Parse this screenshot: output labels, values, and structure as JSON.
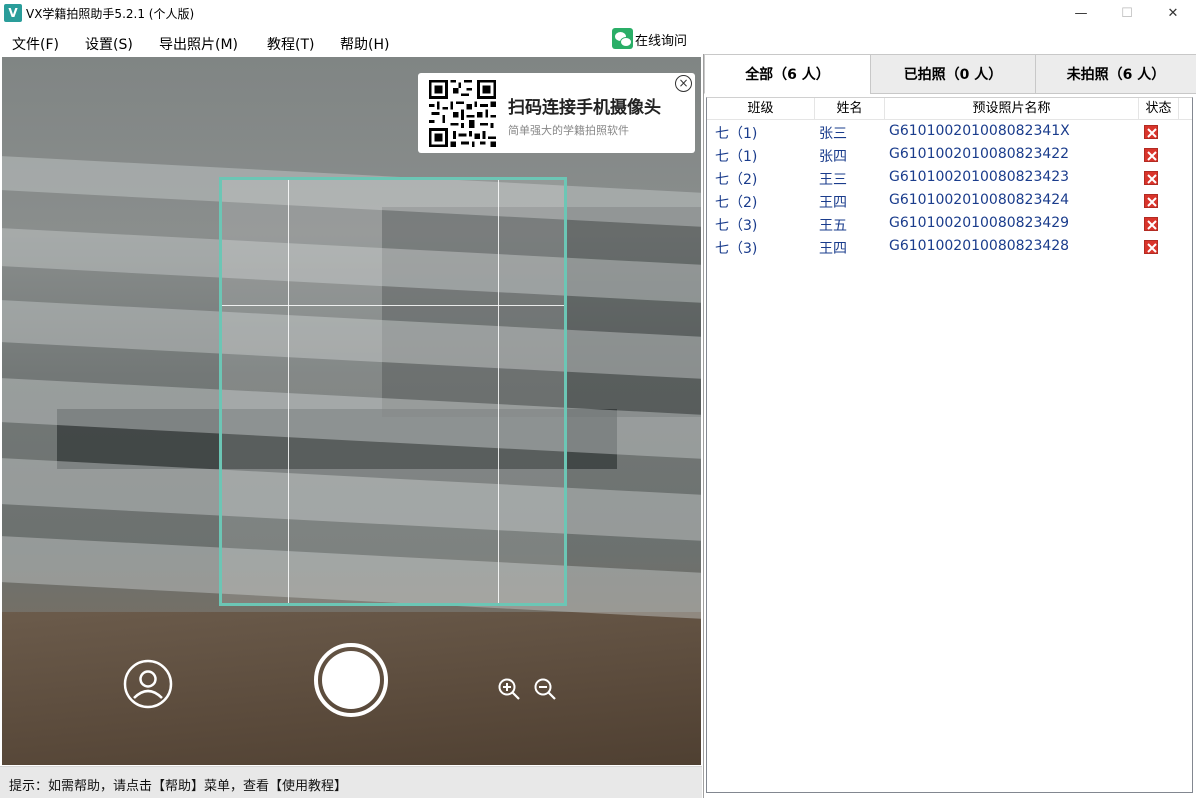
{
  "window": {
    "title": "VX学籍拍照助手5.2.1 (个人版)",
    "app_icon_letter": "V",
    "min_glyph": "—",
    "max_glyph": "☐",
    "close_glyph": "✕"
  },
  "menu": {
    "items": [
      "文件(F)",
      "设置(S)",
      "导出照片(M)",
      "教程(T)",
      "帮助(H)"
    ],
    "online_label": "在线询问"
  },
  "qr_card": {
    "title": "扫码连接手机摄像头",
    "subtitle": "简单强大的学籍拍照软件",
    "close_glyph": "×"
  },
  "status_bar": {
    "text": "提示：如需帮助，请点击【帮助】菜单，查看【使用教程】"
  },
  "tabs": [
    {
      "label": "全部（6 人）",
      "active": true
    },
    {
      "label": "已拍照（0 人）",
      "active": false
    },
    {
      "label": "未拍照（6 人）",
      "active": false
    }
  ],
  "table": {
    "headers": {
      "class": "班级",
      "name": "姓名",
      "photo": "预设照片名称",
      "status": "状态"
    },
    "rows": [
      {
        "class": "七（1)",
        "name": "张三",
        "photo": "G610100201008082341X",
        "status": "not-taken"
      },
      {
        "class": "七（1)",
        "name": "张四",
        "photo": "G6101002010080823422",
        "status": "not-taken"
      },
      {
        "class": "七（2)",
        "name": "王三",
        "photo": "G6101002010080823423",
        "status": "not-taken"
      },
      {
        "class": "七（2)",
        "name": "王四",
        "photo": "G6101002010080823424",
        "status": "not-taken"
      },
      {
        "class": "七（3)",
        "name": "王五",
        "photo": "G6101002010080823429",
        "status": "not-taken"
      },
      {
        "class": "七（3)",
        "name": "王四",
        "photo": "G6101002010080823428",
        "status": "not-taken"
      }
    ]
  },
  "icons": {
    "avatar": "user-avatar-icon",
    "shutter": "shutter-icon",
    "zoom_in": "zoom-in-icon",
    "zoom_out": "zoom-out-icon",
    "status": "red-x-icon",
    "wechat": "wechat-icon"
  },
  "colors": {
    "guide_frame": "#6cc6b5",
    "status_red": "#d9342b",
    "row_text": "#1a3c8c",
    "wechat_green": "#2aae67"
  }
}
